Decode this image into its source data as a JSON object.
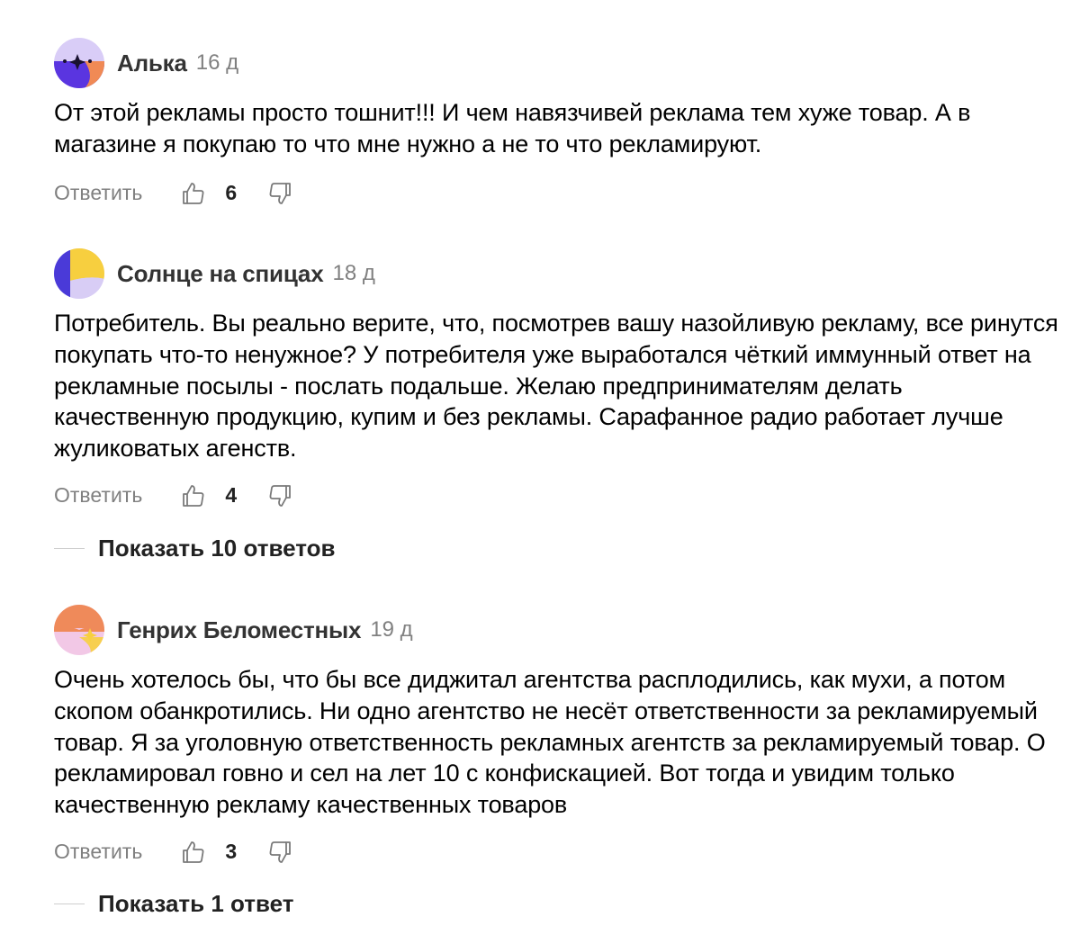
{
  "comments": [
    {
      "author": "Алька",
      "time": "16 д",
      "text": "От этой рекламы просто тошнит!!! И чем навязчивей реклама тем хуже товар. А в магазине я покупаю то что мне нужно а не то что рекламируют.",
      "reply_label": "Ответить",
      "likes": "6",
      "avatar_icon": "avatar-purple-sparkle-icon"
    },
    {
      "author": "Солнце на спицах",
      "time": "18 д",
      "text": "Потребитель. Вы реально верите, что, посмотрев вашу назойливую рекламу, все ринутся покупать что-то ненужное? У потребителя уже выработался чёткий иммунный ответ на рекламные посылы - послать подальше. Желаю предпринимателям делать качественную продукцию, купим и без рекламы. Сарафанное радио работает лучше жуликоватых агенств.",
      "reply_label": "Ответить",
      "likes": "4",
      "show_replies": "Показать 10 ответов",
      "avatar_icon": "avatar-blue-yellow-icon"
    },
    {
      "author": "Генрих Беломестных",
      "time": "19 д",
      "text": "Очень хотелось бы, что бы все диджитал агентства расплодились, как мухи, а потом скопом обанкротились. Ни одно агентство не несёт ответственности за рекламируемый товар. Я за уголовную ответственность рекламных агентств за рекламируемый товар. О рекламировал говно и сел на лет 10 с конфискацией. Вот тогда и увидим только качественную рекламу качественных товаров",
      "reply_label": "Ответить",
      "likes": "3",
      "show_replies": "Показать 1 ответ",
      "avatar_icon": "avatar-orange-pink-icon"
    }
  ],
  "colors": {
    "author": "#333333",
    "meta": "#808080",
    "text": "#000000",
    "divider": "#cfcfcf"
  },
  "icons": {
    "like": "thumbs-up-icon",
    "dislike": "thumbs-down-icon"
  }
}
